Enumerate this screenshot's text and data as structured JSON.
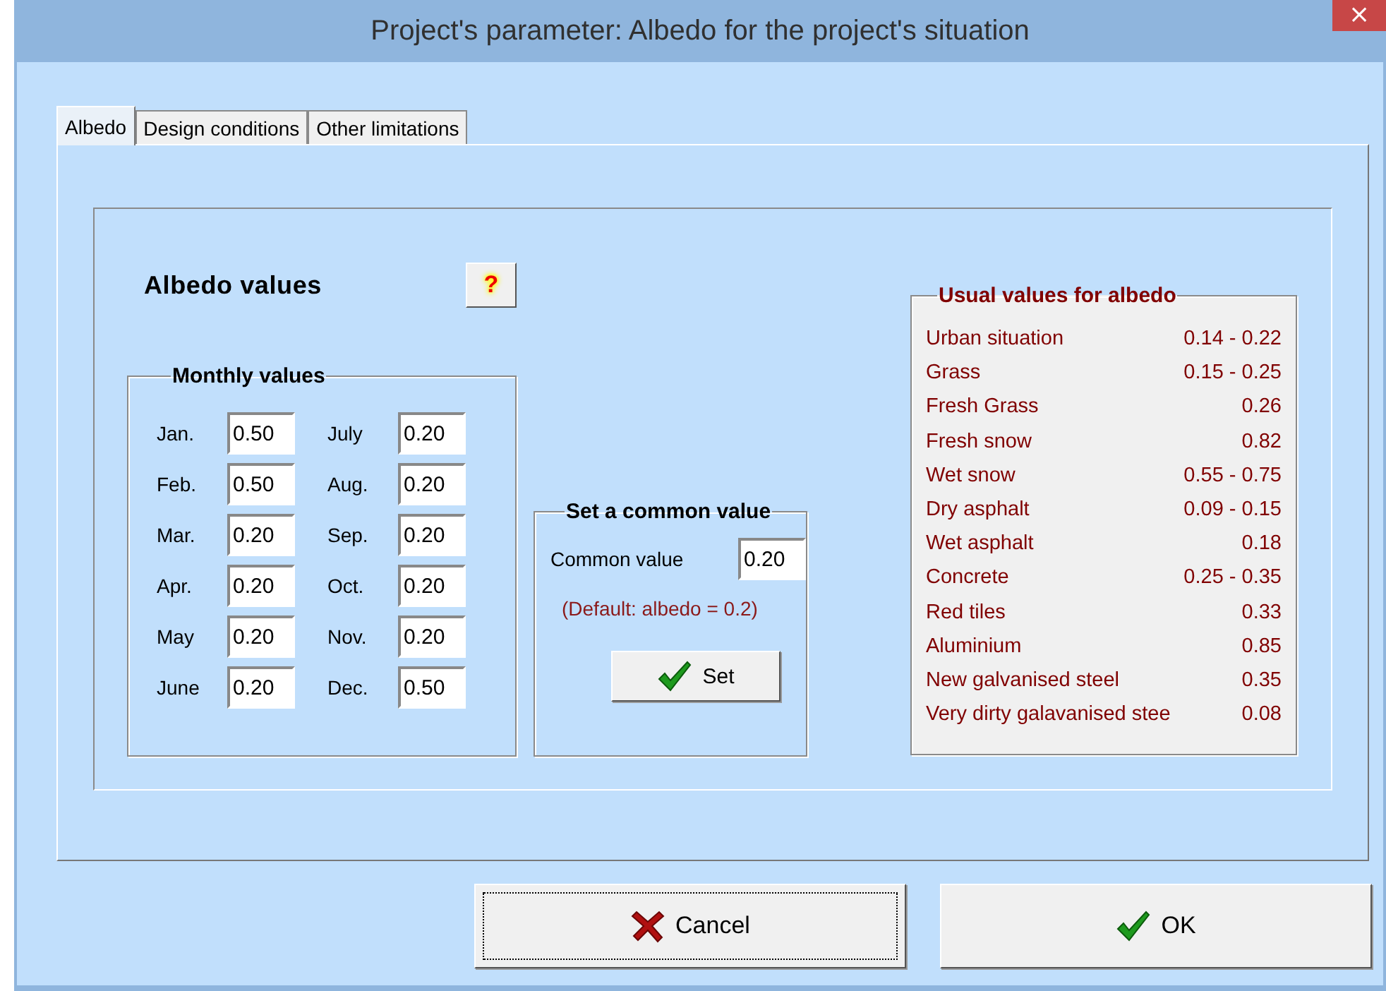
{
  "window": {
    "title": "Project's parameter: Albedo for the project's situation",
    "close": "×"
  },
  "tabs": [
    {
      "label": "Albedo",
      "selected": true
    },
    {
      "label": "Design conditions",
      "selected": false
    },
    {
      "label": "Other limitations",
      "selected": false
    }
  ],
  "albedo_values": {
    "title": "Albedo values",
    "help": "?"
  },
  "monthly": {
    "legend": "Monthly values",
    "months": [
      {
        "label": "Jan.",
        "value": "0.50"
      },
      {
        "label": "Feb.",
        "value": "0.50"
      },
      {
        "label": "Mar.",
        "value": "0.20"
      },
      {
        "label": "Apr.",
        "value": "0.20"
      },
      {
        "label": "May",
        "value": "0.20"
      },
      {
        "label": "June",
        "value": "0.20"
      },
      {
        "label": "July",
        "value": "0.20"
      },
      {
        "label": "Aug.",
        "value": "0.20"
      },
      {
        "label": "Sep.",
        "value": "0.20"
      },
      {
        "label": "Oct.",
        "value": "0.20"
      },
      {
        "label": "Nov.",
        "value": "0.20"
      },
      {
        "label": "Dec.",
        "value": "0.50"
      }
    ]
  },
  "common": {
    "legend": "Set a common value",
    "label": "Common value",
    "value": "0.20",
    "note": "(Default: albedo = 0.2)",
    "button": "Set"
  },
  "usual": {
    "legend": "Usual values for albedo",
    "rows": [
      {
        "name": "Urban situation",
        "value": "0.14 - 0.22"
      },
      {
        "name": "Grass",
        "value": "0.15 - 0.25"
      },
      {
        "name": "Fresh Grass",
        "value": "0.26"
      },
      {
        "name": "Fresh snow",
        "value": "0.82"
      },
      {
        "name": "Wet snow",
        "value": "0.55 - 0.75"
      },
      {
        "name": "Dry asphalt",
        "value": "0.09 - 0.15"
      },
      {
        "name": "Wet asphalt",
        "value": "0.18"
      },
      {
        "name": "Concrete",
        "value": "0.25 - 0.35"
      },
      {
        "name": "Red tiles",
        "value": "0.33"
      },
      {
        "name": "Aluminium",
        "value": "0.85"
      },
      {
        "name": "New galvanised steel",
        "value": "0.35"
      },
      {
        "name": "Very dirty galavanised stee",
        "value": "0.08"
      }
    ]
  },
  "buttons": [
    {
      "label": "Cancel",
      "kind": "cancel",
      "focused": true
    },
    {
      "label": "OK",
      "kind": "ok",
      "focused": false
    }
  ]
}
